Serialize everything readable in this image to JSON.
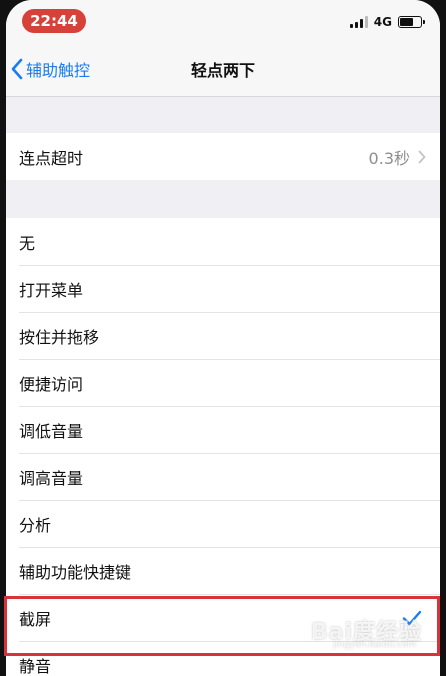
{
  "status_bar": {
    "time": "22:44",
    "network": "4G",
    "accent_color": "#d6413a"
  },
  "nav": {
    "back_label": "辅助触控",
    "title": "轻点两下",
    "tint_color": "#1a7cf2"
  },
  "timeout_row": {
    "label": "连点超时",
    "value": "0.3秒"
  },
  "actions": [
    {
      "label": "无",
      "selected": false
    },
    {
      "label": "打开菜单",
      "selected": false
    },
    {
      "label": "按住并拖移",
      "selected": false
    },
    {
      "label": "便捷访问",
      "selected": false
    },
    {
      "label": "调低音量",
      "selected": false
    },
    {
      "label": "调高音量",
      "selected": false
    },
    {
      "label": "分析",
      "selected": false
    },
    {
      "label": "辅助功能快捷键",
      "selected": false
    },
    {
      "label": "截屏",
      "selected": true
    },
    {
      "label": "静音",
      "selected": false
    }
  ],
  "watermark": {
    "text": "Bai度经验",
    "url": "jingyan.baidu.com"
  },
  "icons": {
    "back": "chevron-left-icon",
    "disclosure": "chevron-right-icon",
    "check": "checkmark-icon"
  }
}
